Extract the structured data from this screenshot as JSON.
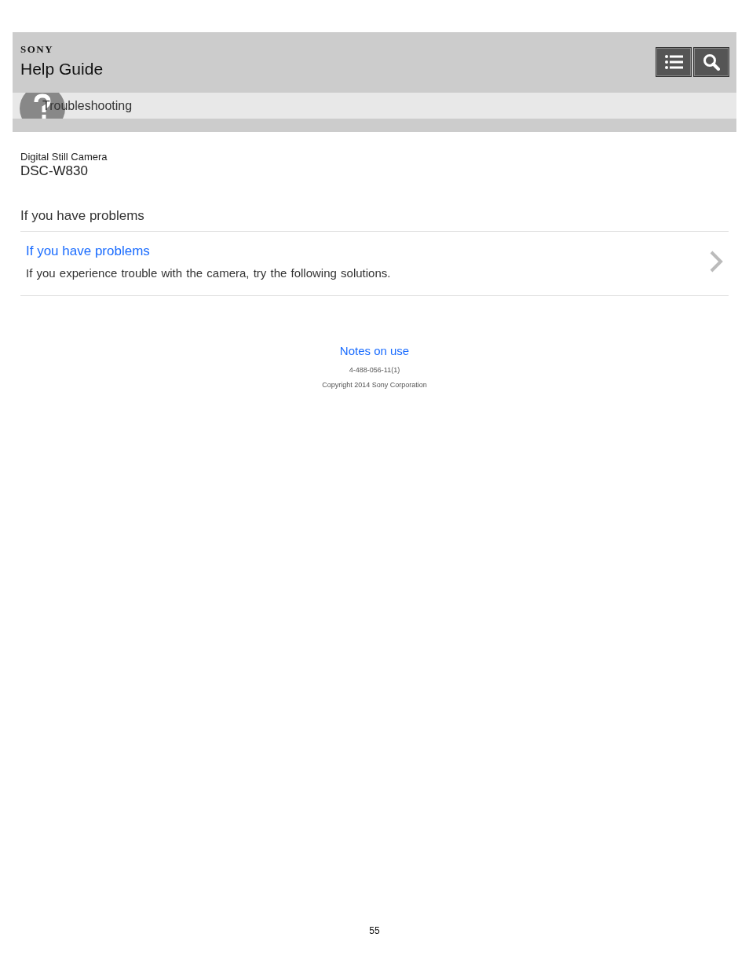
{
  "header": {
    "brand": "SONY",
    "title": "Help Guide",
    "buttons": [
      {
        "kind": "menu"
      },
      {
        "kind": "search"
      }
    ]
  },
  "breadcrumb": {
    "label": "Troubleshooting"
  },
  "product": {
    "category": "Digital Still Camera",
    "model": "DSC-W830"
  },
  "section": {
    "title": "If you have problems",
    "items": [
      {
        "title": "If you have problems",
        "description": "If you experience trouble with the camera, try the following solutions."
      }
    ]
  },
  "footer": {
    "link": "Notes on use",
    "code": "4-488-056-11(1)",
    "copyright": "Copyright 2014 Sony Corporation"
  },
  "page_number": "55"
}
